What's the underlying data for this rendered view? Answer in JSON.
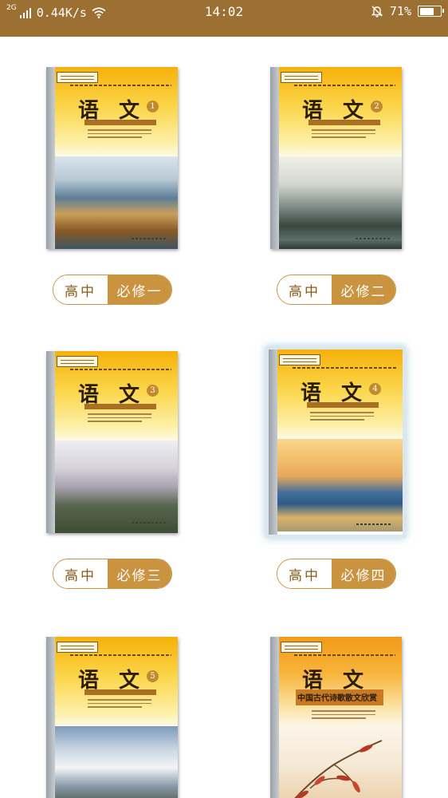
{
  "status_bar": {
    "network_type": "2G",
    "speed": "0.44K/s",
    "time": "14:02",
    "battery_text": "71%",
    "battery_level": 0.71,
    "icons": [
      "signal-icon",
      "wifi-icon",
      "mute-icon",
      "battery-icon"
    ]
  },
  "colors": {
    "status_bar_bg": "#9c6f33",
    "pill_accent": "#c9933f",
    "pill_text": "#8a5a18",
    "background": "#ffffff"
  },
  "books": [
    {
      "cover_title": "语 文",
      "cover_number": "1",
      "level_label": "高中",
      "volume_label": "必修一",
      "selected": false
    },
    {
      "cover_title": "语 文",
      "cover_number": "2",
      "level_label": "高中",
      "volume_label": "必修二",
      "selected": false
    },
    {
      "cover_title": "语 文",
      "cover_number": "3",
      "level_label": "高中",
      "volume_label": "必修三",
      "selected": false
    },
    {
      "cover_title": "语 文",
      "cover_number": "4",
      "level_label": "高中",
      "volume_label": "必修四",
      "selected": true
    },
    {
      "cover_title": "语 文",
      "cover_number": "5",
      "level_label": "",
      "volume_label": "",
      "selected": false
    },
    {
      "cover_title": "语 文",
      "cover_number": "",
      "cover_subtitle": "中国古代诗歌散文欣赏",
      "level_label": "",
      "volume_label": "",
      "selected": false
    }
  ]
}
